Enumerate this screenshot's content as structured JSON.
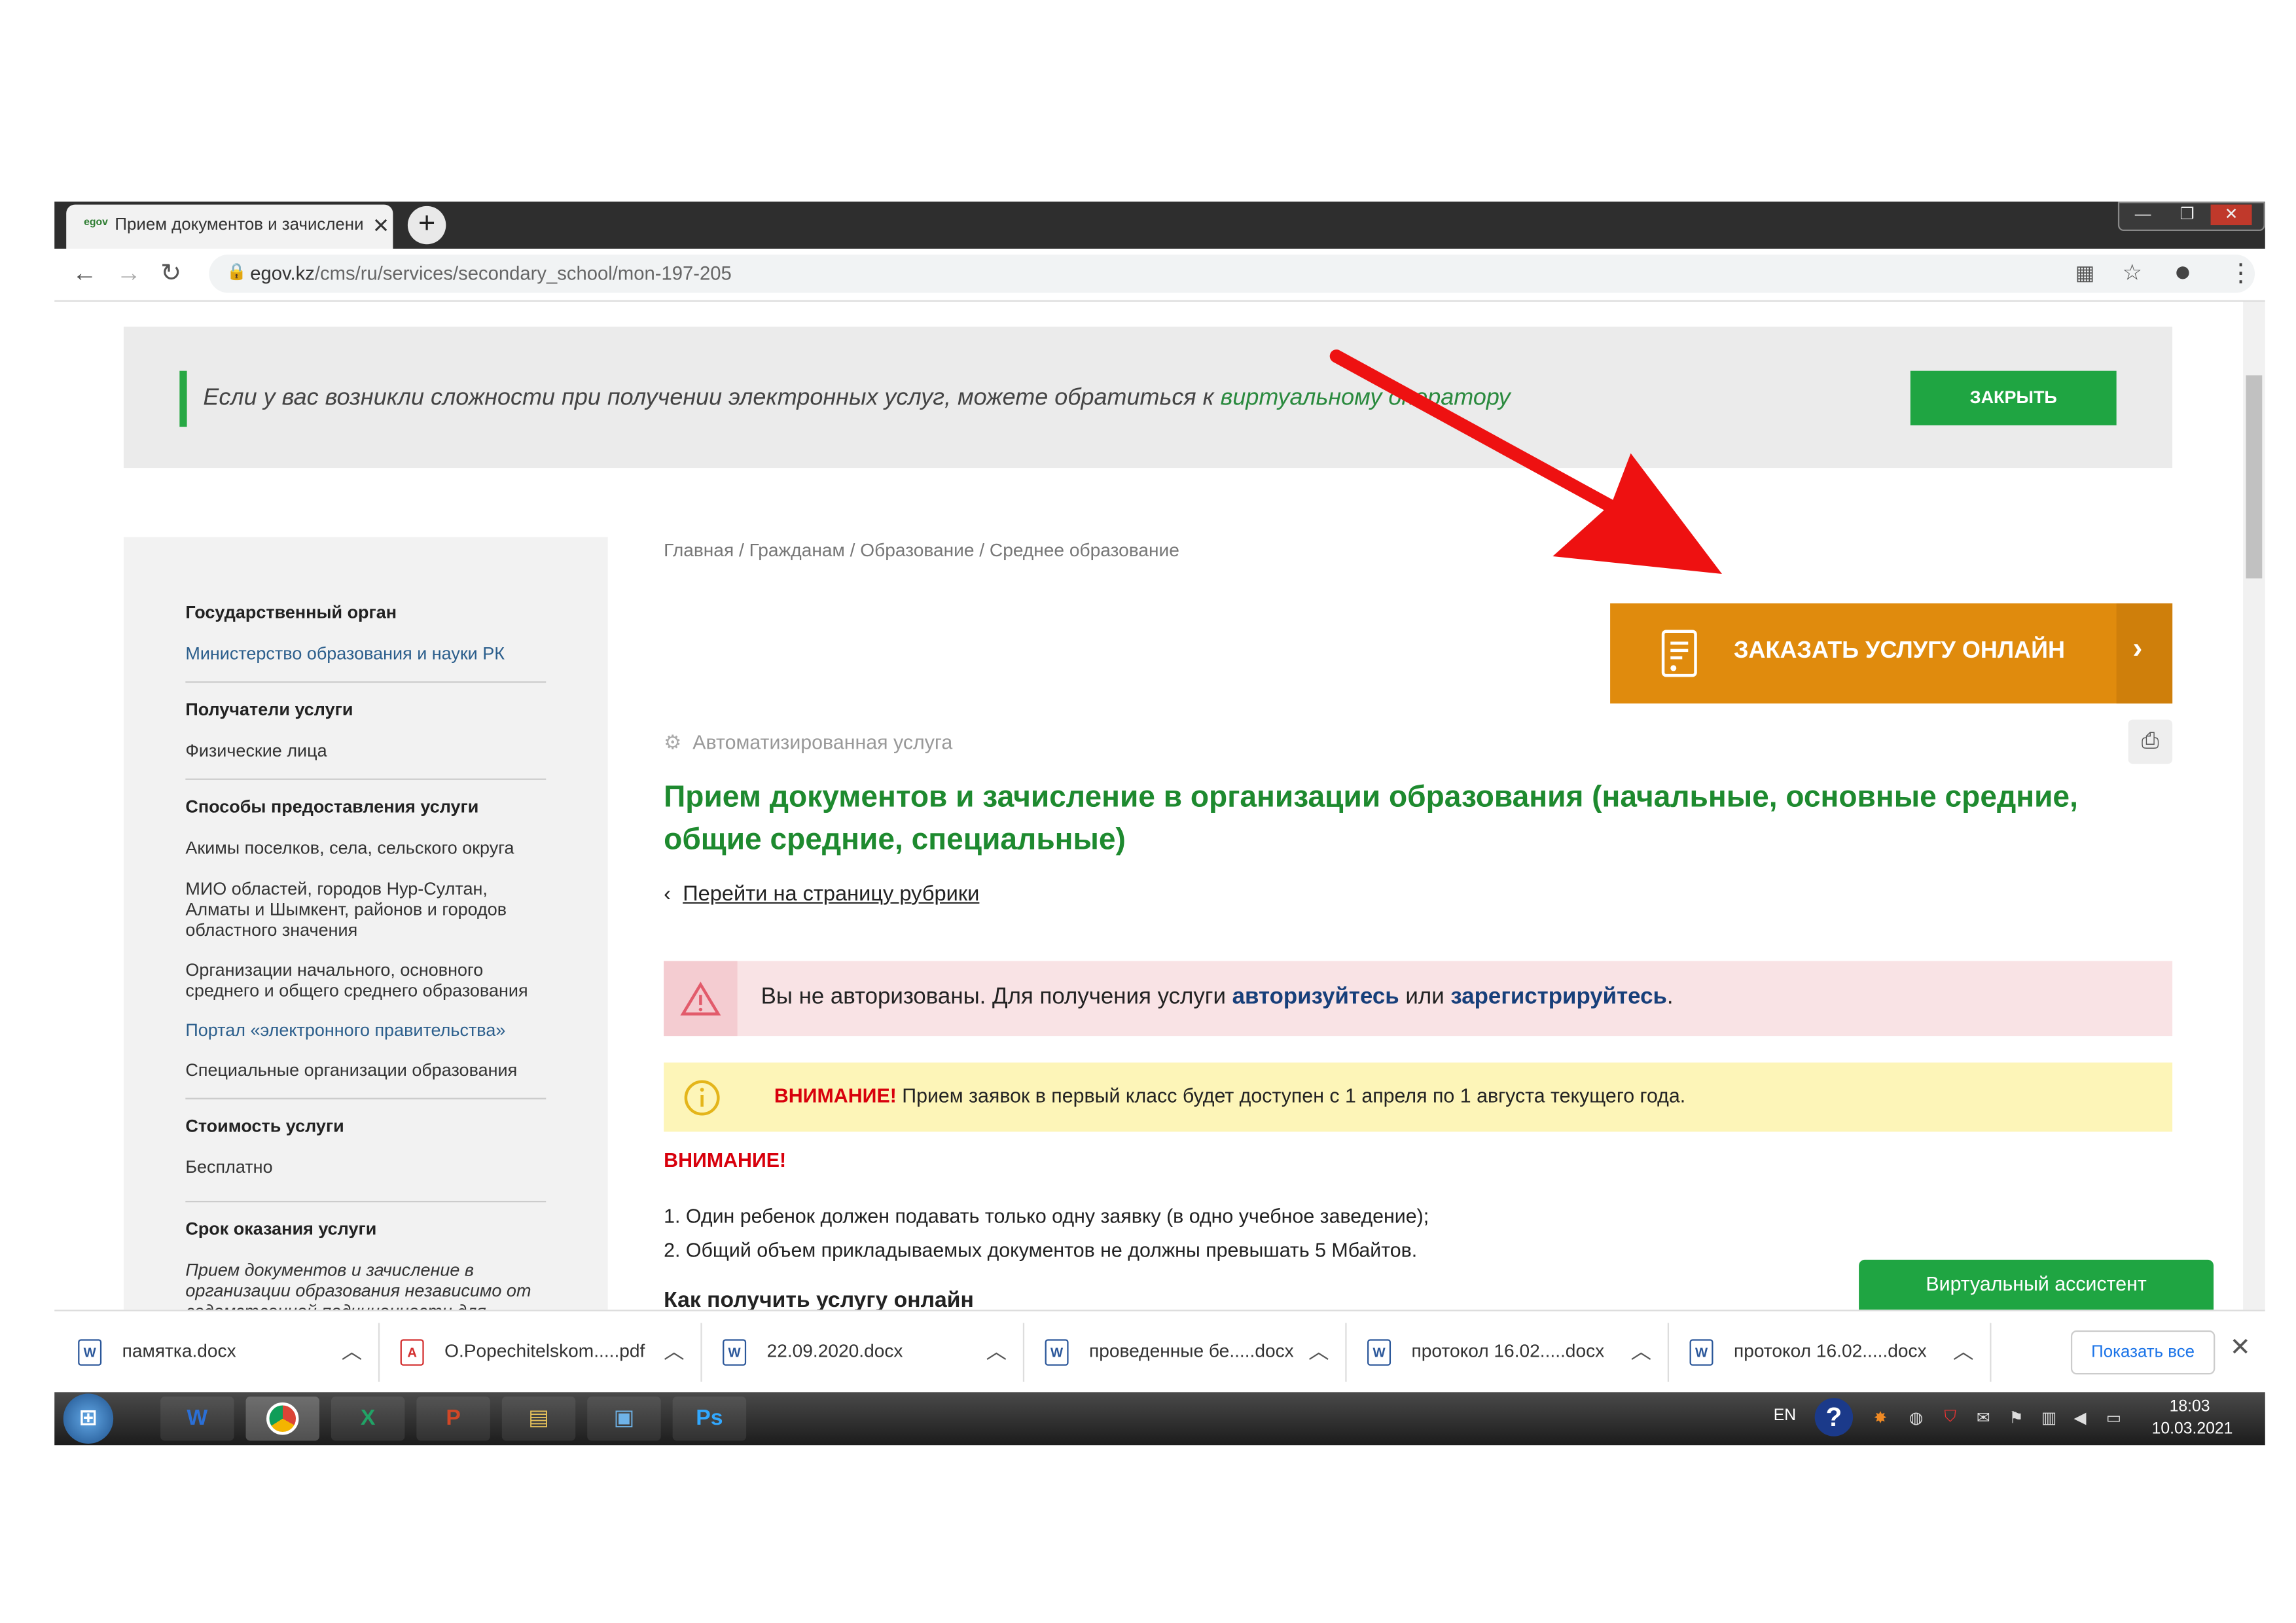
{
  "browser": {
    "tab_favicon": "egov",
    "tab_title": "Прием документов и зачислени",
    "url_domain": "egov.kz",
    "url_path": "/cms/ru/services/secondary_school/mon-197-205"
  },
  "notice": {
    "text_before": "Если у вас возникли сложности при получении электронных услуг, можете обратиться к ",
    "link": "виртуальному оператору",
    "close_label": "ЗАКРЫТЬ"
  },
  "breadcrumb": "Главная / Гражданам / Образование / Среднее образование",
  "sidebar": {
    "gov_heading": "Государственный орган",
    "gov_value": "Министерство образования и науки РК",
    "recipients_heading": "Получатели услуги",
    "recipients_value": "Физические лица",
    "methods_heading": "Способы предоставления услуги",
    "methods": [
      "Акимы поселков, села, сельского округа",
      "МИО областей, городов Нур-Султан, Алматы и Шымкент, районов и городов областного значения",
      "Организации начального, основного среднего и общего среднего образования",
      "Портал «электронного правительства»",
      "Специальные организации образования"
    ],
    "cost_heading": "Стоимость услуги",
    "cost_value": "Бесплатно",
    "term_heading": "Срок оказания услуги",
    "term_value": "Прием документов и зачисление в организации образования независимо от ведомственной подчиненности для"
  },
  "main": {
    "order_button": "ЗАКАЗАТЬ УСЛУГУ ОНЛАЙН",
    "automated_label": "Автоматизированная услуга",
    "title": "Прием документов и зачисление в организации образования (начальные, основные средние, общие средние, специальные)",
    "rubric_link": "Перейти на страницу рубрики",
    "auth_text_1": "Вы не авторизованы. Для получения услуги ",
    "auth_link_login": "авторизуйтесь",
    "auth_text_2": " или ",
    "auth_link_register": "зарегистрируйтесь",
    "auth_text_3": ".",
    "warn_bold": "ВНИМАНИЕ!",
    "warn_text": " Прием заявок  в первый класс будет доступен с 1 апреля по 1 августа текущего года.",
    "attention": "ВНИМАНИЕ!",
    "rules": [
      "1. Один ребенок должен подавать только одну заявку (в одно учебное заведение);",
      "2. Общий объем прикладываемых документов не должны превышать 5 Мбайтов."
    ],
    "howto": "Как получить услугу онлайн",
    "assistant": "Виртуальный ассистент"
  },
  "downloads": {
    "items": [
      "памятка.docx",
      "O.Popechitelskom.....pdf",
      "22.09.2020.docx",
      "проведенные бе.....docx",
      "протокол  16.02.....docx",
      "протокол 16.02.....docx"
    ],
    "show_all": "Показать все"
  },
  "taskbar": {
    "lang": "EN",
    "time": "18:03",
    "date": "10.03.2021"
  },
  "colors": {
    "accent_green": "#1fa542",
    "order_orange": "#e08b0d",
    "alert_red": "#d8000c",
    "arrow_red": "#ee1111"
  }
}
